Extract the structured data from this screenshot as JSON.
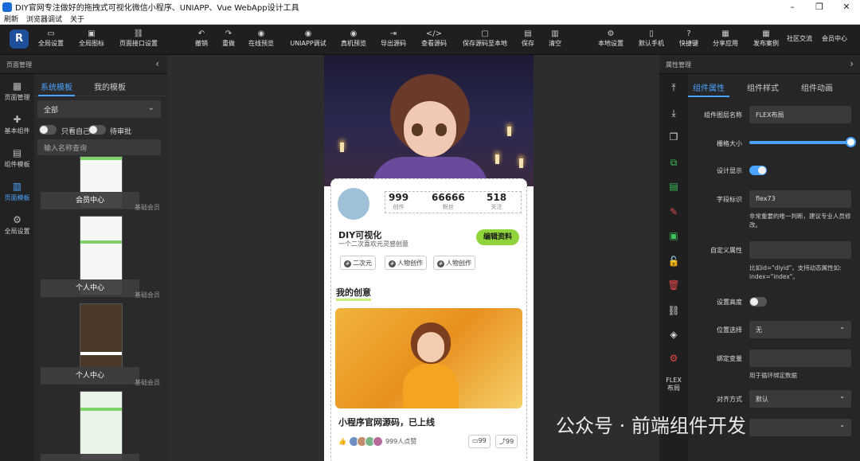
{
  "window": {
    "title": "DIY官网专注做好的拖拽式可视化微信小程序、UNIAPP、Vue WebApp设计工具",
    "minimize": "–",
    "maximize": "❐",
    "close": "✕"
  },
  "menu": [
    "刷新",
    "浏览器调试",
    "关于"
  ],
  "toolbar": {
    "items": [
      {
        "label": "全局设置",
        "icon": "▭"
      },
      {
        "label": "全局图标",
        "icon": "▣"
      },
      {
        "label": "页面接口设置",
        "icon": "⛓"
      },
      {
        "label": "撤销",
        "icon": "↶"
      },
      {
        "label": "重做",
        "icon": "↷"
      },
      {
        "label": "在线预览",
        "icon": "◉"
      },
      {
        "label": "UNIAPP调试",
        "icon": "◉"
      },
      {
        "label": "真机预览",
        "icon": "◉"
      },
      {
        "label": "导出源码",
        "icon": "⇥"
      },
      {
        "label": "查看源码",
        "icon": "</>"
      },
      {
        "label": "保存源码至本地",
        "icon": "▢"
      },
      {
        "label": "保存",
        "icon": "▤"
      },
      {
        "label": "清空",
        "icon": "▥"
      },
      {
        "label": "本地设置",
        "icon": "⚙"
      },
      {
        "label": "默认手机",
        "icon": "▯"
      },
      {
        "label": "快捷键",
        "icon": "?"
      },
      {
        "label": "分享应用",
        "icon": "▦"
      },
      {
        "label": "发布案例",
        "icon": "▦"
      },
      {
        "label": "社区交流",
        "icon": ""
      },
      {
        "label": "会员中心",
        "icon": ""
      }
    ]
  },
  "left": {
    "header": "页面管理",
    "collapse_icon": "‹",
    "nav": [
      {
        "label": "页面管理",
        "icon": "▦"
      },
      {
        "label": "基本组件",
        "icon": "✚"
      },
      {
        "label": "组件模板",
        "icon": "▤"
      },
      {
        "label": "页面模板",
        "icon": "▥"
      },
      {
        "label": "全局设置",
        "icon": "⚙"
      }
    ],
    "tabs": [
      "系统模板",
      "我的模板"
    ],
    "filter": "全部",
    "toggle1": "只看自己",
    "toggle2": "待审批",
    "search_placeholder": "输入名称查询",
    "templates": [
      {
        "button": "会员中心",
        "category": "基础会员"
      },
      {
        "button": "个人中心",
        "category": "基础会员"
      },
      {
        "button": "个人中心",
        "category": "基础会员"
      }
    ]
  },
  "phone": {
    "stats": [
      {
        "n": "999",
        "l": "创作"
      },
      {
        "n": "66666",
        "l": "粉丝"
      },
      {
        "n": "518",
        "l": "关注"
      }
    ],
    "name": "DIY可视化",
    "subtitle": "一个二次喜欢元灵感创意",
    "edit_button": "编辑资料",
    "tags": [
      "二次元",
      "人物创作",
      "人物创作"
    ],
    "tag_icon": "#",
    "section_title": "我的创意",
    "post_title": "小程序官网源码，已上线",
    "likes_text": "999人点赞",
    "like_icon": "👍",
    "comments": "99",
    "comment_icon": "▭",
    "shares": "99",
    "share_icon": "⤴"
  },
  "right": {
    "header": "属性管理",
    "collapse_icon": "›",
    "tabs": [
      "组件属性",
      "组件样式",
      "组件动画"
    ],
    "icons": [
      "⤒",
      "⤓",
      "❐",
      "⧉",
      "▤",
      "✎",
      "▣",
      "🔓",
      "🗑",
      "⛓",
      "◈",
      "⚙"
    ],
    "flex_label": "FLEX\n布局",
    "props": {
      "layer_name_label": "组件图层名称",
      "layer_name_value": "FLEX布局",
      "grid_label": "栅格大小",
      "design_show_label": "设计显示",
      "field_label": "字段标识",
      "field_value": "flex73",
      "field_help": "非常重要的唯一判断，建议专业人员修改。",
      "custom_attr_label": "自定义属性",
      "custom_attr_help": "比如id=\"diyid\"，支持动态属性如: index=\"index\"。",
      "height_label": "设置高度",
      "position_label": "位置选择",
      "position_value": "无",
      "bind_label": "绑定变量",
      "bind_help": "用于循环绑定数据",
      "align_label": "对齐方式",
      "align_value": "默认"
    }
  },
  "watermark": "公众号 · 前端组件开发"
}
